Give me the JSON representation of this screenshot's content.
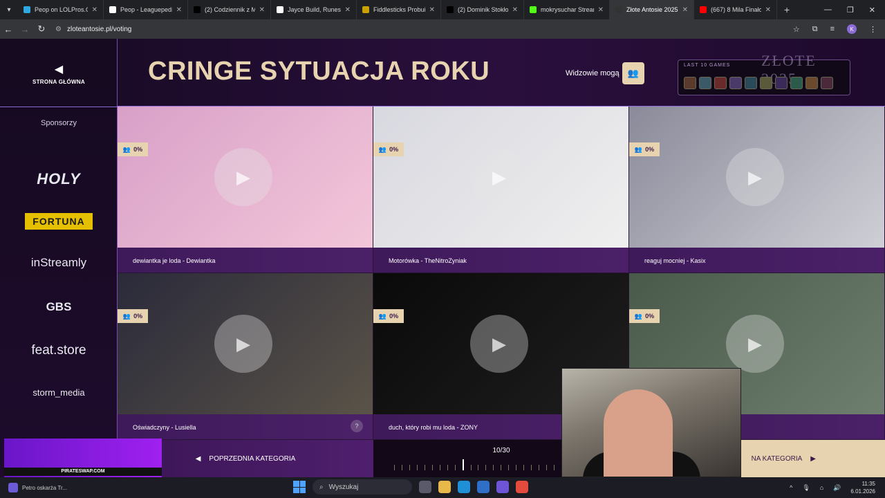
{
  "browser": {
    "tabs": [
      {
        "label": "Peop on LOLPros.GG",
        "color": "#2ea8e0",
        "active": false
      },
      {
        "label": "Peop - Leaguepedia |",
        "color": "#ffffff",
        "active": false
      },
      {
        "label": "(2) Codziennik z Mor",
        "color": "#000000",
        "active": false
      },
      {
        "label": "Jayce Build, Runes, an",
        "color": "#ffffff",
        "active": false
      },
      {
        "label": "Fiddlesticks Probuild",
        "color": "#c8a000",
        "active": false
      },
      {
        "label": "(2) Dominik Stokłosa",
        "color": "#000000",
        "active": false
      },
      {
        "label": "mokrysuchar Stream",
        "color": "#53fc18",
        "active": false
      },
      {
        "label": "Złote Antosie 2025 -",
        "color": "#333333",
        "active": true
      },
      {
        "label": "(667) 8 Mila Finałowa",
        "color": "#ff0000",
        "active": false
      }
    ],
    "url": "zloteantosie.pl/voting",
    "profile_initial": "K"
  },
  "sidebar": {
    "home_label": "STRONA GŁÓWNA",
    "sponsors_title": "Sponsorzy",
    "sponsors": [
      "HOLY",
      "FORTUNA",
      "inStreamly",
      "GBS",
      "feat.store",
      "storm_media"
    ]
  },
  "header": {
    "title": "CRINGE SYTUACJA ROKU",
    "viewers_label": "Widzowie mogą",
    "last_game_label": "LAST 10 GAMES",
    "logo_text": "ZŁOTE 2025"
  },
  "nominees": [
    {
      "caption": "dewiantka je loda - Dewiantka",
      "percent": "0%",
      "thumb": [
        "#d8a0c8",
        "#f3c6d9"
      ]
    },
    {
      "caption": "Motorówka - TheNitroZyniak",
      "percent": "0%",
      "thumb": [
        "#d8d8e0",
        "#efefef"
      ]
    },
    {
      "caption": "reaguj mocniej - Kasix",
      "percent": "0%",
      "thumb": [
        "#8a8a9a",
        "#cfd0d6"
      ]
    },
    {
      "caption": "Oświadczyny - Lusiella",
      "percent": "0%",
      "thumb": [
        "#2a2a3a",
        "#5a5348"
      ]
    },
    {
      "caption": "duch, który robi mu loda - ZONY",
      "percent": "0%",
      "thumb": [
        "#0a0a0a",
        "#1e1e1e"
      ]
    },
    {
      "caption": "",
      "percent": "0%",
      "thumb": [
        "#4a5a4a",
        "#6f7f6f"
      ]
    }
  ],
  "footer": {
    "prev_label": "POPRZEDNIA KATEGORIA",
    "counter": "10/30",
    "current": 10,
    "total": 30,
    "next_label": "NA KATEGORIA"
  },
  "promo": {
    "text": "PIRATESWAP.COM"
  },
  "taskbar": {
    "news": "Petro oskarża Tr...",
    "search_placeholder": "Wyszukaj",
    "time": "11:35",
    "date": "6.01.2026"
  }
}
